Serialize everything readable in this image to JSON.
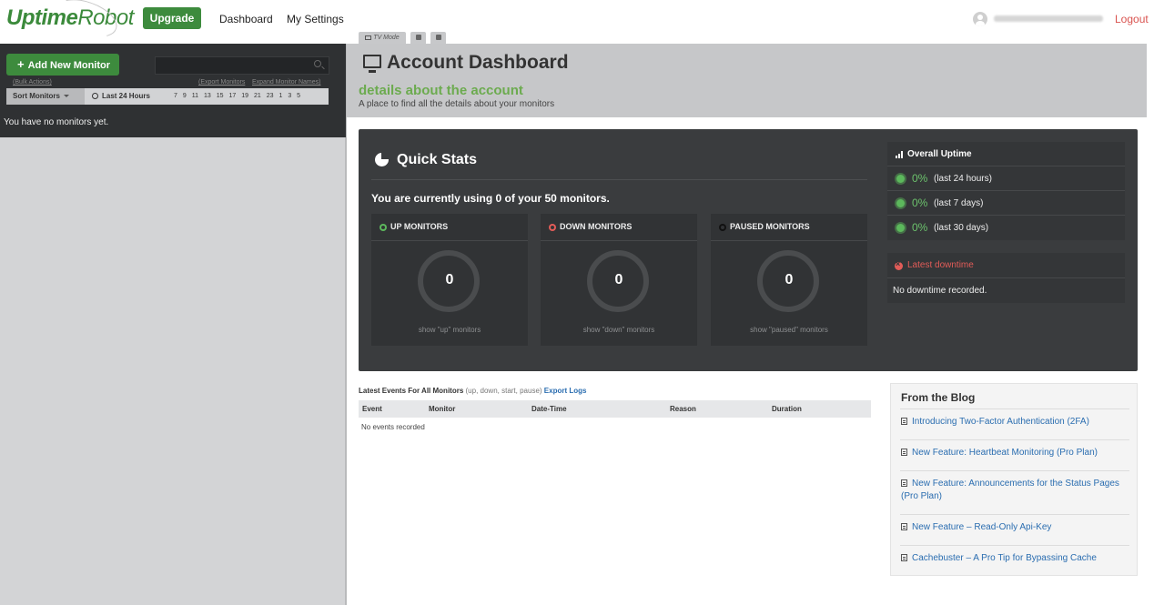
{
  "app": {
    "logo_part1": "Uptime",
    "logo_part2": "Robot"
  },
  "topnav": {
    "upgrade_label": "Upgrade",
    "dashboard_label": "Dashboard",
    "settings_label": "My Settings",
    "logout_label": "Logout"
  },
  "sidebar": {
    "add_monitor_label": "Add New Monitor",
    "bulk_actions_label": "(Bulk Actions)",
    "export_monitors_label": "(Export Monitors",
    "expand_names_label": "Expand Monitor Names)",
    "sort_label": "Sort Monitors",
    "period_label": "Last 24 Hours",
    "hours": [
      "7",
      "9",
      "11",
      "13",
      "15",
      "17",
      "19",
      "21",
      "23",
      "1",
      "3",
      "5"
    ],
    "empty_text": "You have no monitors yet."
  },
  "header": {
    "tv_mode_label": "TV Mode",
    "title": "Account Dashboard",
    "subtitle": "details about the account",
    "description": "A place to find all the details about your monitors"
  },
  "quick_stats": {
    "title": "Quick Stats",
    "usage_text": "You are currently using 0 of your 50 monitors.",
    "boxes": [
      {
        "label": "UP MONITORS",
        "count": "0",
        "link": "show \"up\" monitors",
        "color": "#5cb85c"
      },
      {
        "label": "DOWN MONITORS",
        "count": "0",
        "link": "show \"down\" monitors",
        "color": "#e25c58"
      },
      {
        "label": "PAUSED MONITORS",
        "count": "0",
        "link": "show \"paused\" monitors",
        "color": "#111111"
      }
    ]
  },
  "overall_uptime": {
    "title": "Overall Uptime",
    "rows": [
      {
        "pct": "0%",
        "range": "(last 24 hours)"
      },
      {
        "pct": "0%",
        "range": "(last 7 days)"
      },
      {
        "pct": "0%",
        "range": "(last 30 days)"
      }
    ]
  },
  "latest_downtime": {
    "title": "Latest downtime",
    "text": "No downtime recorded."
  },
  "events": {
    "title": "Latest Events For All Monitors",
    "subtitle": "(up, down, start, pause)",
    "export_label": "Export Logs",
    "columns": [
      "Event",
      "Monitor",
      "Date-Time",
      "Reason",
      "Duration"
    ],
    "empty_text": "No events recorded"
  },
  "blog": {
    "title": "From the Blog",
    "posts": [
      "Introducing Two-Factor Authentication (2FA)",
      "New Feature: Heartbeat Monitoring (Pro Plan)",
      "New Feature: Announcements for the Status Pages (Pro Plan)",
      "New Feature – Read-Only Api-Key",
      "Cachebuster – A Pro Tip for Bypassing Cache"
    ]
  }
}
